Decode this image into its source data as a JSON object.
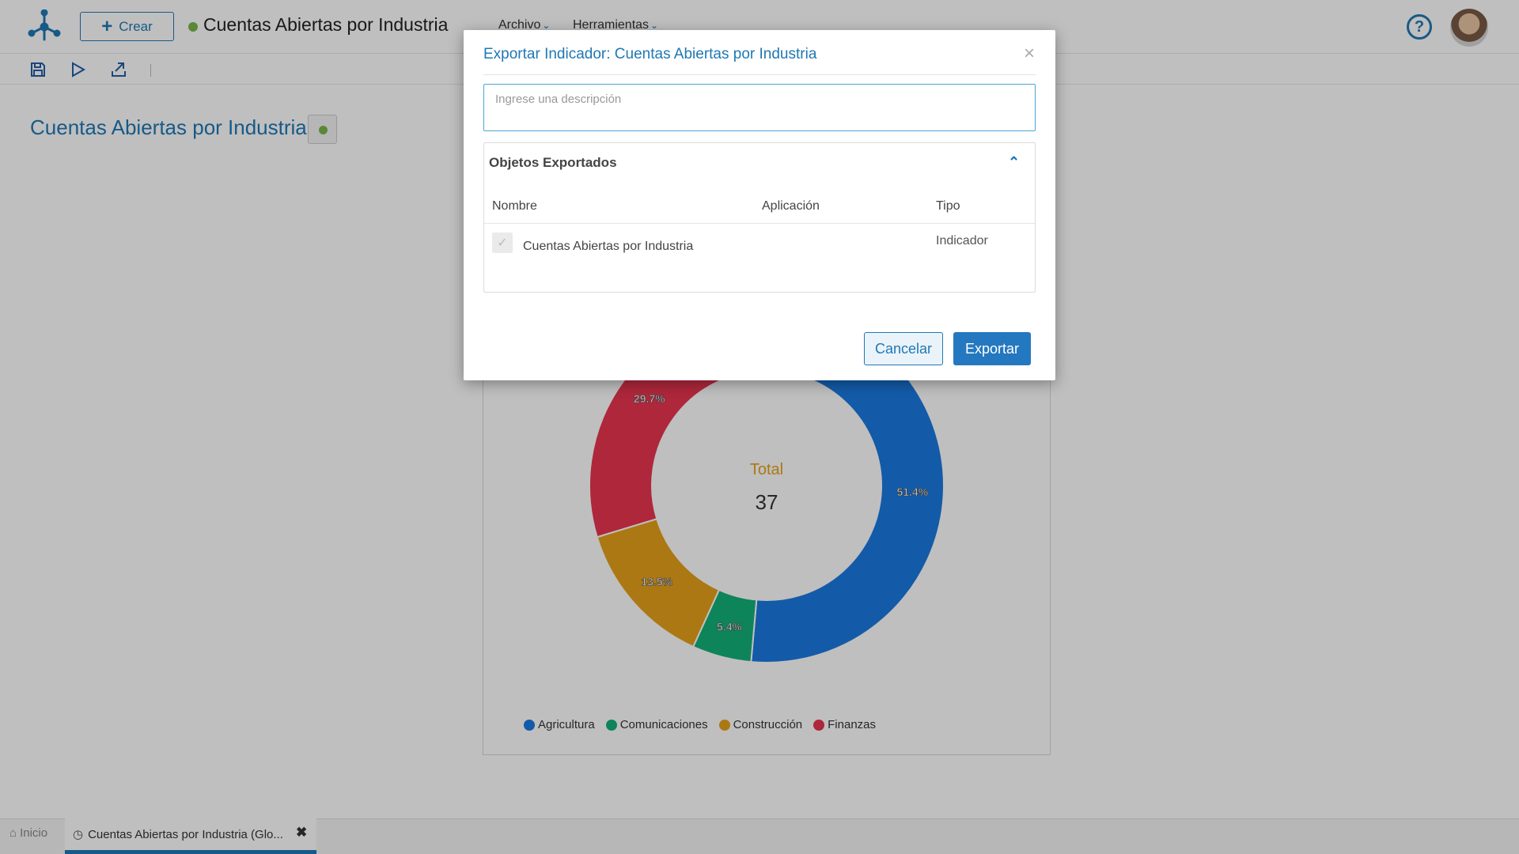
{
  "header": {
    "create_label": "Crear",
    "doc_title": "Cuentas Abiertas por Industria",
    "menus": [
      "Archivo",
      "Herramientas"
    ],
    "help_symbol": "?"
  },
  "toolbar": {
    "icons": [
      "save-icon",
      "play-icon",
      "export-icon"
    ]
  },
  "page": {
    "title": "Cuentas Abiertas por Industria"
  },
  "chart_data": {
    "type": "pie",
    "donut": true,
    "center_label": "Total",
    "center_value": "37",
    "categories": [
      "Agricultura",
      "Comunicaciones",
      "Construcción",
      "Finanzas"
    ],
    "values": [
      51.4,
      5.4,
      13.5,
      29.7
    ],
    "labels": [
      "51.4%",
      "5.4%",
      "13.5%",
      "29.7%"
    ],
    "colors": [
      "#1a7ae0",
      "#13b07a",
      "#e6a11a",
      "#e8354f"
    ],
    "legend_position": "bottom"
  },
  "modal": {
    "title": "Exportar Indicador: Cuentas Abiertas por Industria",
    "close_symbol": "×",
    "description_placeholder": "Ingrese una descripción",
    "section_title": "Objetos Exportados",
    "columns": [
      "Nombre",
      "Aplicación",
      "Tipo"
    ],
    "rows": [
      {
        "name": "Cuentas Abiertas por Industria",
        "application": "",
        "type": "Indicador"
      }
    ],
    "cancel_label": "Cancelar",
    "export_label": "Exportar"
  },
  "bottom_tabs": {
    "home_label": "Inicio",
    "active_label": "Cuentas Abiertas por Industria (Glo...",
    "close_symbol": "✖"
  }
}
